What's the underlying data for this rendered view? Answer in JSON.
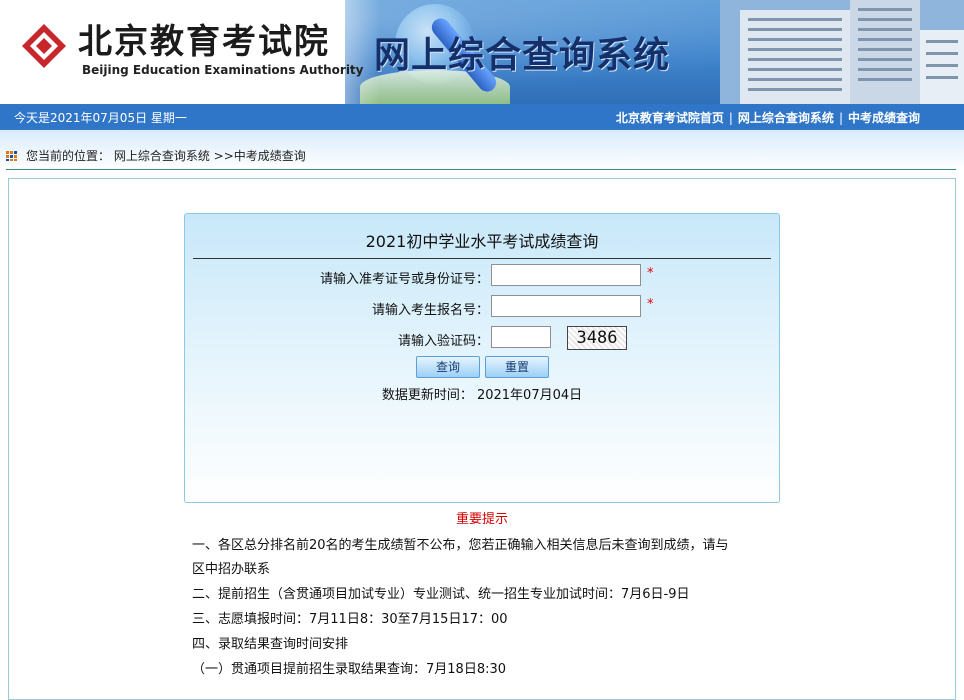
{
  "header": {
    "logo_cn": "北京教育考试院",
    "logo_en": "Beijing Education Examinations Authority",
    "system_title": "网上综合查询系统"
  },
  "topbar": {
    "date": "今天是2021年07月05日 星期一",
    "nav": [
      "北京教育考试院首页",
      "网上综合查询系统",
      "中考成绩查询"
    ]
  },
  "breadcrumb": {
    "prefix": "您当前的位置：",
    "path": "网上综合查询系统 >>中考成绩查询"
  },
  "form": {
    "title": "2021初中学业水平考试成绩查询",
    "id_label": "请输入准考证号或身份证号：",
    "id_value": "",
    "reg_label": "请输入考生报名号：",
    "reg_value": "",
    "captcha_label": "请输入验证码：",
    "captcha_value": "",
    "captcha_image_text": "3486",
    "required_mark": "*",
    "query_button": "查询",
    "reset_button": "重置",
    "update_time": "数据更新时间： 2021年07月04日"
  },
  "notice": {
    "title": "重要提示",
    "lines": [
      "一、各区总分排名前20名的考生成绩暂不公布，您若正确输入相关信息后未查询到成绩，请与",
      "区中招办联系",
      "二、提前招生（含贯通项目加试专业）专业测试、统一招生专业加试时间：7月6日-9日",
      "三、志愿填报时间：7月11日8：30至7月15日17：00",
      "四、录取结果查询时间安排",
      "（一）贯通项目提前招生录取结果查询：7月18日8:30"
    ]
  },
  "colors": {
    "topbar": "#2f76c9",
    "title_navy": "#14306b",
    "required_red": "#e00000",
    "notice_red": "#d40000"
  }
}
